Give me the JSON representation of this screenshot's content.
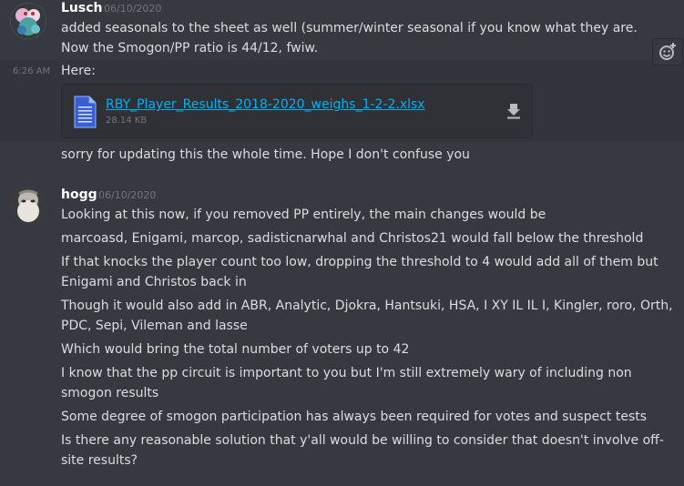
{
  "messages": [
    {
      "author": "Lusch",
      "date": "06/10/2020",
      "lines": [
        "added seasonals to the sheet as well (summer/winter seasonal if you know what they are. Now the Smogon/PP ratio is 44/12, fwiw."
      ]
    },
    {
      "side_time": "6:26 AM",
      "text": "Here:",
      "attachment": {
        "filename": "RBY_Player_Results_2018-2020_weighs_1-2-2.xlsx",
        "size": "28.14 KB"
      }
    },
    {
      "text": "sorry for updating this the whole time. Hope I don't confuse you"
    },
    {
      "author": "hogg",
      "date": "06/10/2020",
      "lines": [
        "Looking at this now, if you removed PP entirely, the main changes would be",
        "marcoasd, Enigami, marcop, sadisticnarwhal and Christos21 would fall below the threshold",
        "If that knocks the player count too low, dropping the threshold to 4 would add all of them but Enigami and Christos back in",
        "Though it would also add in ABR, Analytic, Djokra, Hantsuki, HSA, I XY IL IL I, Kingler, roro, Orth, PDC, Sepi, Vileman and lasse",
        "Which would bring the total number of voters up to 42",
        "I know that the pp circuit is important to you but I'm still extremely wary of including non smogon results",
        "Some degree of smogon participation has always been required for votes and suspect tests",
        "Is there any reasonable solution that y'all would be willing to consider that doesn't involve off-site results?"
      ]
    }
  ]
}
